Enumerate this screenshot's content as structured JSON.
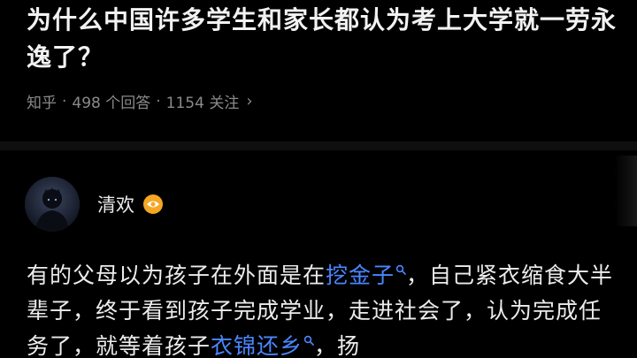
{
  "question": {
    "title": "为什么中国许多学生和家长都认为考上大学就一劳永逸了？",
    "source": "知乎",
    "answers_count": "498 个回答",
    "followers": "1154 关注"
  },
  "author": {
    "name": "清欢",
    "badge_icon": "eye-badge-icon"
  },
  "answer": {
    "seg1": "有的父母以为孩子在外面是在",
    "kw1": "挖金子",
    "seg2": "，自己紧衣缩食大半辈子，终于看到孩子完成学业，走进社会了，认为完成任务了，就等着孩子",
    "kw2": "衣锦还乡",
    "seg3": "，扬"
  },
  "colors": {
    "background": "#000000",
    "text": "#ececec",
    "meta": "#8a8a8a",
    "link": "#4a86ff",
    "badge": "#f5a623"
  }
}
